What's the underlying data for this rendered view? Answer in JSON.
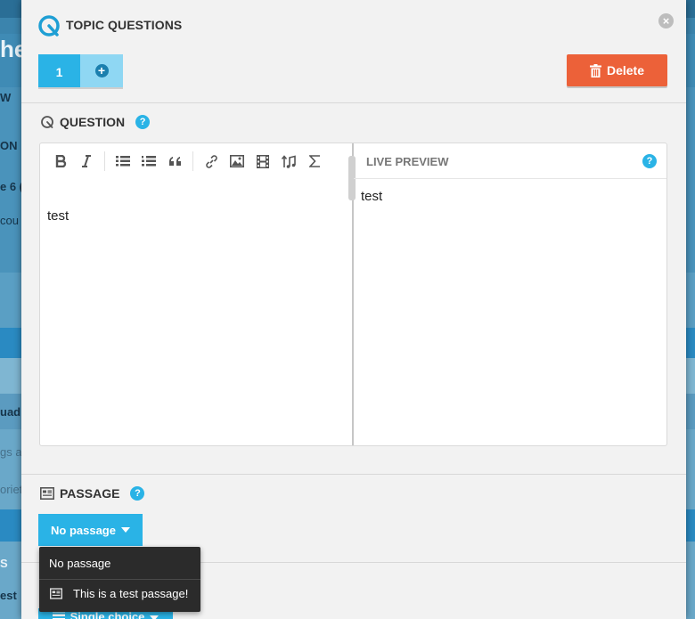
{
  "modal": {
    "title": "TOPIC QUESTIONS",
    "close_symbol": "×",
    "tabs": [
      {
        "label": "1"
      }
    ],
    "add_tab_symbol": "+",
    "delete_label": "Delete"
  },
  "question": {
    "label": "QUESTION",
    "help_symbol": "?",
    "editor_text": "test",
    "toolbar": [
      "bold-icon",
      "italic-icon",
      "unordered-list-icon",
      "ordered-list-icon",
      "quote-icon",
      "link-icon",
      "image-icon",
      "video-icon",
      "audio-icon",
      "formula-icon"
    ],
    "preview": {
      "title": "LIVE PREVIEW",
      "help_symbol": "?",
      "text": "test"
    }
  },
  "passage": {
    "label": "PASSAGE",
    "help_symbol": "?",
    "button_label": "No passage",
    "options": [
      {
        "label": "No passage"
      },
      {
        "label": "This is a test passage!"
      }
    ]
  },
  "answer_type": {
    "button_label": "Single choice"
  },
  "background": {
    "fragments": [
      "he",
      "W",
      "ON",
      "e 6 (",
      "cou",
      "uadr",
      "gs a",
      "oriet",
      "S",
      "est"
    ]
  },
  "colors": {
    "accent": "#2ab3e6",
    "danger": "#ec6139",
    "modal_bg": "#f2f2f2",
    "dropdown_bg": "#2b2b2b"
  }
}
